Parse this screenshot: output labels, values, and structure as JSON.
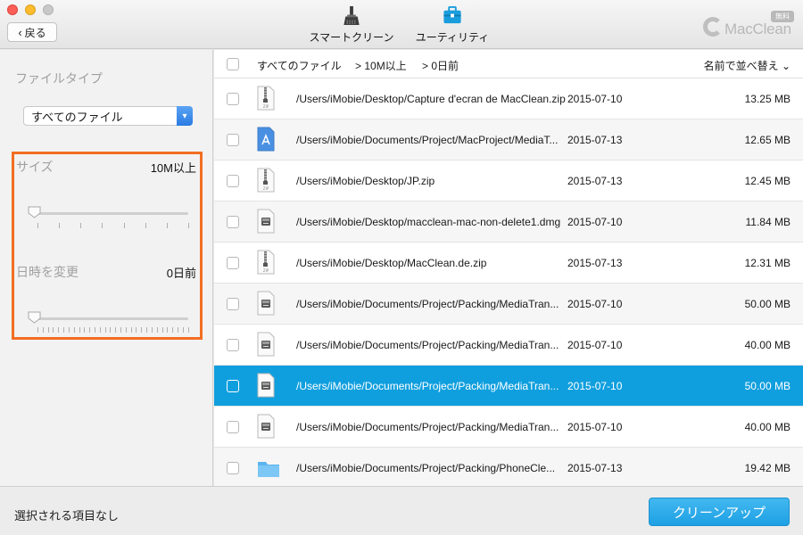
{
  "toolbar": {
    "back_label": "戻る",
    "tabs": [
      {
        "label": "スマートクリーン",
        "icon": "broom-icon"
      },
      {
        "label": "ユーティリティ",
        "icon": "toolbox-icon",
        "active": true
      }
    ],
    "logo_text": "MacClean",
    "logo_badge": "無料",
    "accent_color": "#1a9ddd"
  },
  "sidebar": {
    "filetype_label": "ファイルタイプ",
    "filetype_selected": "すべてのファイル",
    "size_label": "サイズ",
    "size_value": "10M以上",
    "size_slider_position": 0,
    "date_label": "日時を変更",
    "date_value": "0日前",
    "date_slider_position": 0,
    "highlight_color": "#f26e22"
  },
  "list": {
    "header": {
      "all_files": "すべてのファイル",
      "size_filter": "> 10M以上",
      "date_filter": "> 0日前",
      "sort_label": "名前で並べ替え"
    },
    "rows": [
      {
        "icon": "zip-file-icon",
        "path": "/Users/iMobie/Desktop/Capture d'ecran de MacClean.zip",
        "date": "2015-07-10",
        "size": "13.25 MB"
      },
      {
        "icon": "app-file-icon",
        "path": "/Users/iMobie/Documents/Project/MacProject/MediaT...",
        "date": "2015-07-13",
        "size": "12.65 MB"
      },
      {
        "icon": "zip-file-icon",
        "path": "/Users/iMobie/Desktop/JP.zip",
        "date": "2015-07-13",
        "size": "12.45 MB"
      },
      {
        "icon": "dmg-file-icon",
        "path": "/Users/iMobie/Desktop/macclean-mac-non-delete1.dmg",
        "date": "2015-07-10",
        "size": "11.84 MB"
      },
      {
        "icon": "zip-file-icon",
        "path": "/Users/iMobie/Desktop/MacClean.de.zip",
        "date": "2015-07-13",
        "size": "12.31 MB"
      },
      {
        "icon": "dmg-file-icon",
        "path": "/Users/iMobie/Documents/Project/Packing/MediaTran...",
        "date": "2015-07-10",
        "size": "50.00 MB"
      },
      {
        "icon": "dmg-file-icon",
        "path": "/Users/iMobie/Documents/Project/Packing/MediaTran...",
        "date": "2015-07-10",
        "size": "40.00 MB"
      },
      {
        "icon": "dmg-file-icon",
        "path": "/Users/iMobie/Documents/Project/Packing/MediaTran...",
        "date": "2015-07-10",
        "size": "50.00 MB",
        "selected": true
      },
      {
        "icon": "dmg-file-icon",
        "path": "/Users/iMobie/Documents/Project/Packing/MediaTran...",
        "date": "2015-07-10",
        "size": "40.00 MB"
      },
      {
        "icon": "folder-icon",
        "path": "/Users/iMobie/Documents/Project/Packing/PhoneCle...",
        "date": "2015-07-13",
        "size": "19.42 MB"
      }
    ]
  },
  "footer": {
    "status": "選択される項目なし",
    "cleanup_label": "クリーンアップ"
  }
}
